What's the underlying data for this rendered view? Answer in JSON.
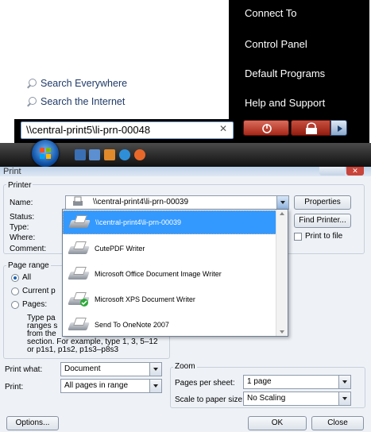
{
  "start_menu": {
    "search_links": [
      "Search Everywhere",
      "Search the Internet"
    ],
    "search_value": "\\\\central-print5\\li-prn-00048",
    "right_items": [
      "Connect To",
      "Control Panel",
      "Default Programs",
      "Help and Support"
    ]
  },
  "dialog": {
    "title": "Print",
    "printer_group": "Printer",
    "name_label": "Name:",
    "name_value": "\\\\central-print4\\li-prn-00039",
    "status_label": "Status:",
    "type_label": "Type:",
    "where_label": "Where:",
    "comment_label": "Comment:",
    "properties_btn": "Properties",
    "find_printer_btn": "Find Printer...",
    "print_to_file": "Print to file",
    "page_range_group": "Page range",
    "range_all": "All",
    "range_current": "Current p",
    "range_pages": "Pages:",
    "range_help_lines": [
      "Type pa",
      "ranges s",
      "from the",
      "section. For example, type 1, 3, 5–12",
      "or p1s1, p1s2, p1s3–p8s3"
    ],
    "print_what_label": "Print what:",
    "print_what_value": "Document",
    "print_label": "Print:",
    "print_value": "All pages in range",
    "zoom_group": "Zoom",
    "pages_per_sheet_label": "Pages per sheet:",
    "pages_per_sheet_value": "1 page",
    "scale_label": "Scale to paper size:",
    "scale_value": "No Scaling",
    "options_btn": "Options...",
    "ok_btn": "OK",
    "close_btn": "Close",
    "printer_list": [
      "\\\\central-print4\\li-prn-00039",
      "CutePDF Writer",
      "Microsoft Office Document Image Writer",
      "Microsoft XPS Document Writer",
      "Send To OneNote 2007"
    ]
  },
  "colors": {
    "selection": "#3399ff",
    "start_menu_bg": "#000000"
  }
}
